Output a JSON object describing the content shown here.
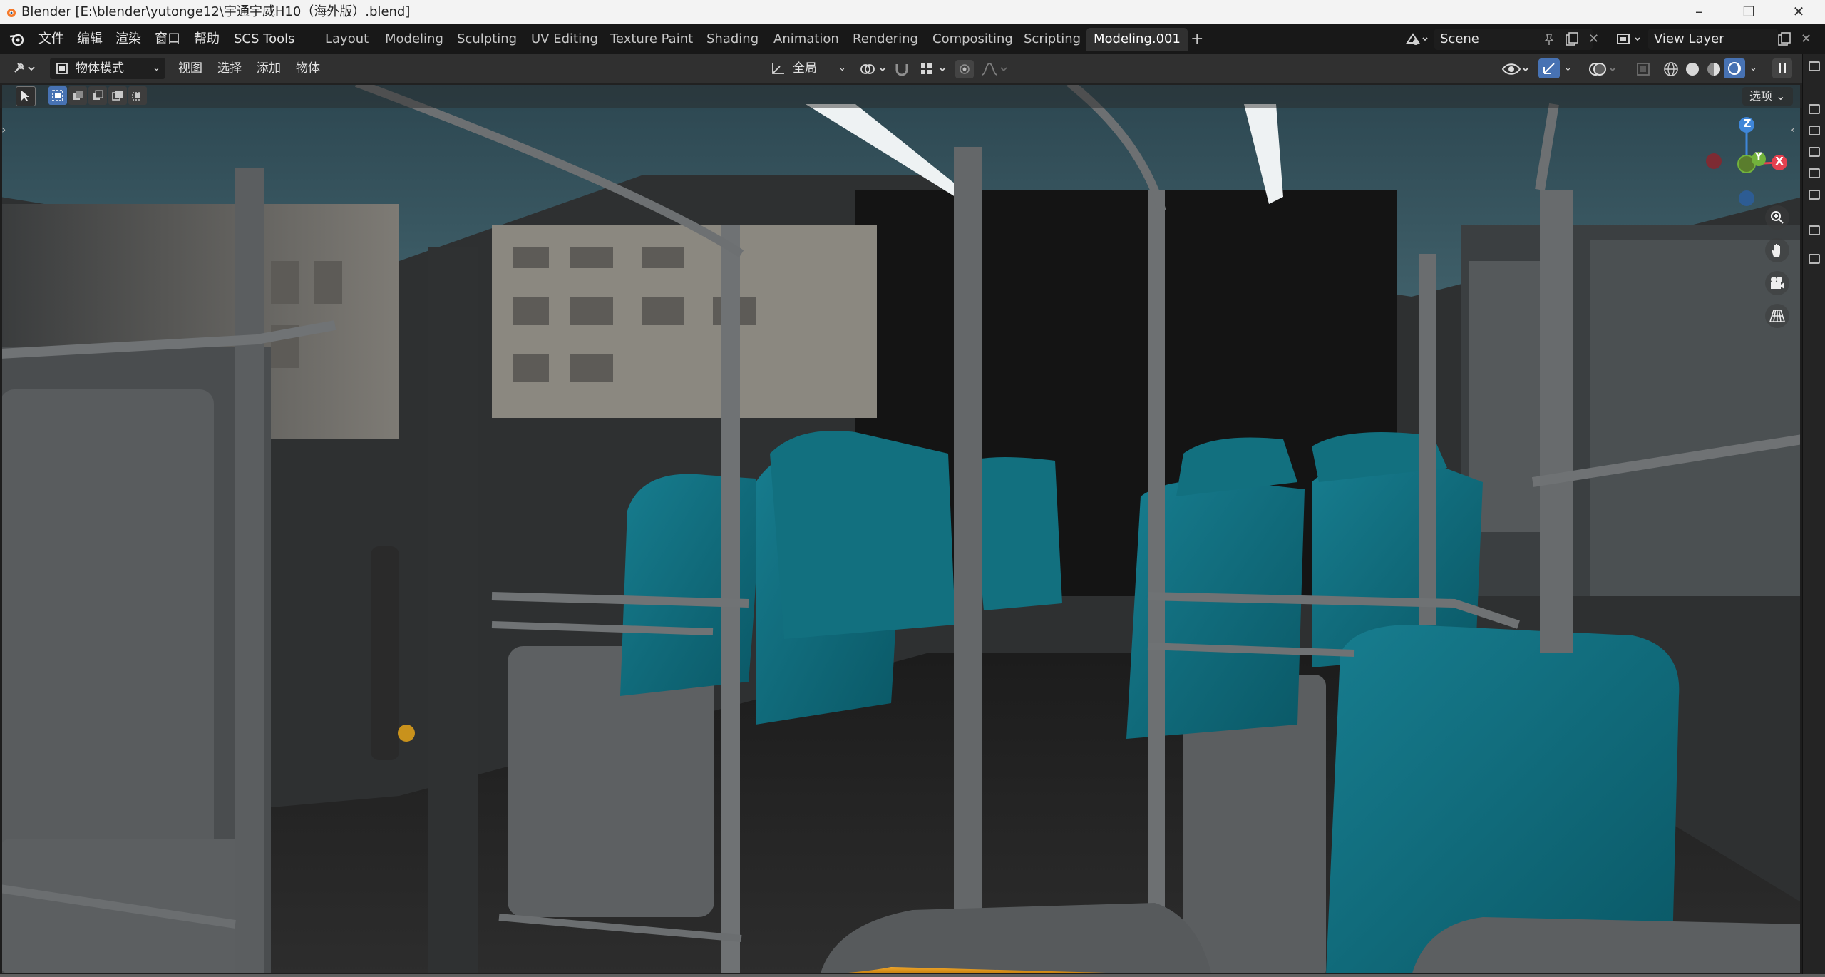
{
  "window": {
    "title": "Blender [E:\\blender\\yutonge12\\宇通宇威H10（海外版）.blend]",
    "controls": {
      "minimize": "–",
      "maximize": "☐",
      "close": "✕"
    }
  },
  "menubar": {
    "items": [
      "文件",
      "编辑",
      "渲染",
      "窗口",
      "帮助",
      "SCS Tools"
    ]
  },
  "workspaces": {
    "tabs": [
      "Layout",
      "Modeling",
      "Sculpting",
      "UV Editing",
      "Texture Paint",
      "Shading",
      "Animation",
      "Rendering",
      "Compositing",
      "Scripting",
      "Modeling.001"
    ],
    "active": "Modeling.001",
    "add": "+"
  },
  "scene": {
    "name": "Scene"
  },
  "view_layer": {
    "name": "View Layer"
  },
  "viewport_header": {
    "mode": "物体模式",
    "menus": [
      "视图",
      "选择",
      "添加",
      "物体"
    ],
    "transform_orientation": "全局"
  },
  "tool_header": {
    "options": "选项 ⌄"
  },
  "gizmo": {
    "axes": {
      "x": "X",
      "y": "Y",
      "z": "Z"
    },
    "colors": {
      "x": "#e5404f",
      "y": "#72b23c",
      "z": "#3f86d8"
    }
  },
  "colors": {
    "active_blue": "#4772b3",
    "seat_teal": "#0f6e7f",
    "seat_orange": "#e59b16"
  }
}
